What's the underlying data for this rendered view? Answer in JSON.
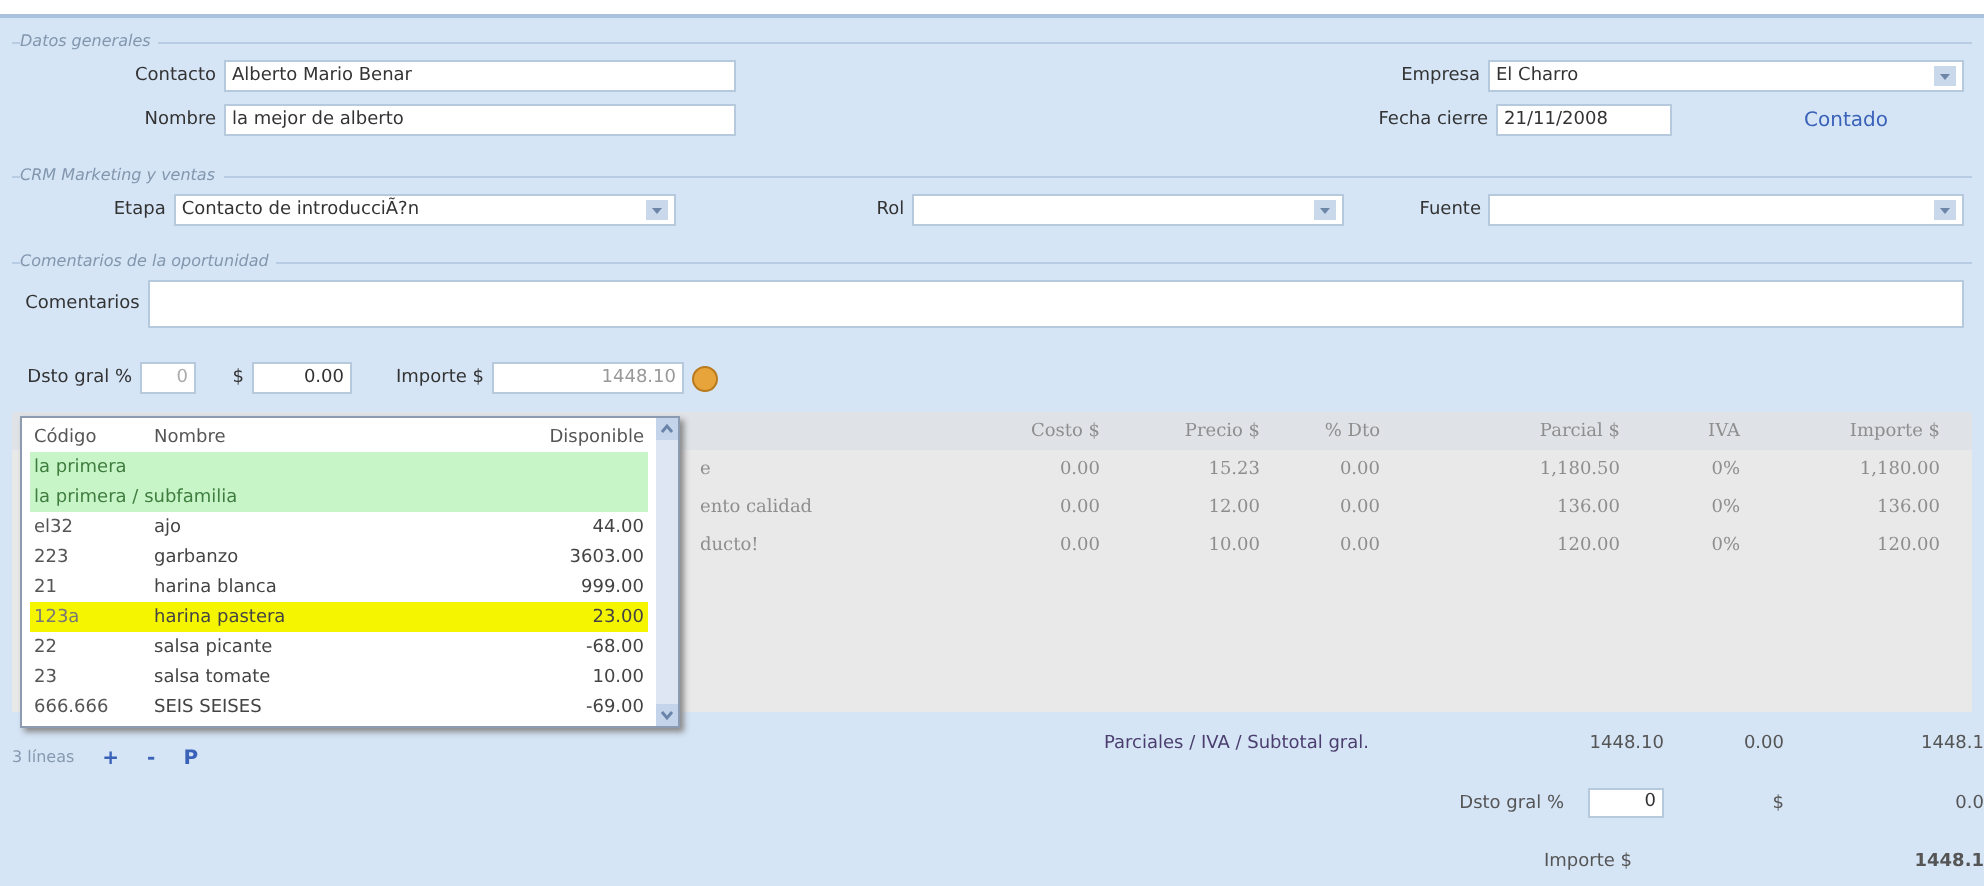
{
  "general": {
    "legend": "Datos generales",
    "contacto": {
      "label": "Contacto",
      "value": "Alberto Mario Benar"
    },
    "nombre": {
      "label": "Nombre",
      "value": "la mejor de alberto"
    },
    "empresa": {
      "label": "Empresa",
      "value": "El Charro"
    },
    "fecha": {
      "label": "Fecha cierre",
      "value": "21/11/2008"
    },
    "link": "Contado"
  },
  "crm": {
    "legend": "CRM Marketing y ventas",
    "etapa": {
      "label": "Etapa",
      "value": "Contacto de introducciÃ?n"
    },
    "rol": {
      "label": "Rol"
    },
    "fuente": {
      "label": "Fuente"
    }
  },
  "comments": {
    "legend": "Comentarios de la oportunidad",
    "label": "Comentarios"
  },
  "discount_bar": {
    "pct_label": "Dsto gral %",
    "pct_value": "0",
    "amount_label": "$",
    "amount_value": "0.00",
    "total_label": "Importe $",
    "total_value": "1448.10"
  },
  "grid": {
    "columns": [
      "Costo $",
      "Precio $",
      "% Dto",
      "Parcial $",
      "IVA",
      "Importe $"
    ],
    "rows": [
      {
        "description": "e",
        "cells": [
          "0.00",
          "15.23",
          "0.00",
          "1,180.50",
          "0%",
          "1,180.00"
        ]
      },
      {
        "description": "ento calidad",
        "cells": [
          "0.00",
          "12.00",
          "0.00",
          "136.00",
          "0%",
          "136.00"
        ]
      },
      {
        "description": "ducto!",
        "cells": [
          "0.00",
          "10.00",
          "0.00",
          "120.00",
          "0%",
          "120.00"
        ]
      }
    ]
  },
  "popup": {
    "columns": [
      "Código",
      "Nombre",
      "Disponible"
    ],
    "rows": [
      {
        "kind": "group",
        "label": "la primera",
        "selected": false
      },
      {
        "kind": "group",
        "label": "la primera / subfamilia",
        "selected": false
      },
      {
        "kind": "item",
        "code": "el32",
        "name": "ajo",
        "available": "44.00",
        "selected": false
      },
      {
        "kind": "item",
        "code": "223",
        "name": "garbanzo",
        "available": "3603.00",
        "selected": false
      },
      {
        "kind": "item",
        "code": "21",
        "name": "harina blanca",
        "available": "999.00",
        "selected": false
      },
      {
        "kind": "item",
        "code": "123a",
        "name": "harina pastera",
        "available": "23.00",
        "selected": true
      },
      {
        "kind": "item",
        "code": "22",
        "name": "salsa picante",
        "available": "-68.00",
        "selected": false
      },
      {
        "kind": "item",
        "code": "23",
        "name": "salsa tomate",
        "available": "10.00",
        "selected": false
      },
      {
        "kind": "item",
        "code": "666.666",
        "name": "SEIS SEISES",
        "available": "-69.00",
        "selected": false
      }
    ]
  },
  "footer": {
    "count": "3 líneas",
    "actions": [
      "+",
      "-",
      "P"
    ],
    "subtotal": {
      "label": "Parciales / IVA / Subtotal gral.",
      "values": [
        "1448.10",
        "0.00",
        "1448.1"
      ]
    },
    "discount": {
      "label": "Dsto gral %",
      "value": "0",
      "currency": "$",
      "amount": "0.0"
    },
    "total": {
      "label": "Importe $",
      "value": "1448.1"
    }
  }
}
